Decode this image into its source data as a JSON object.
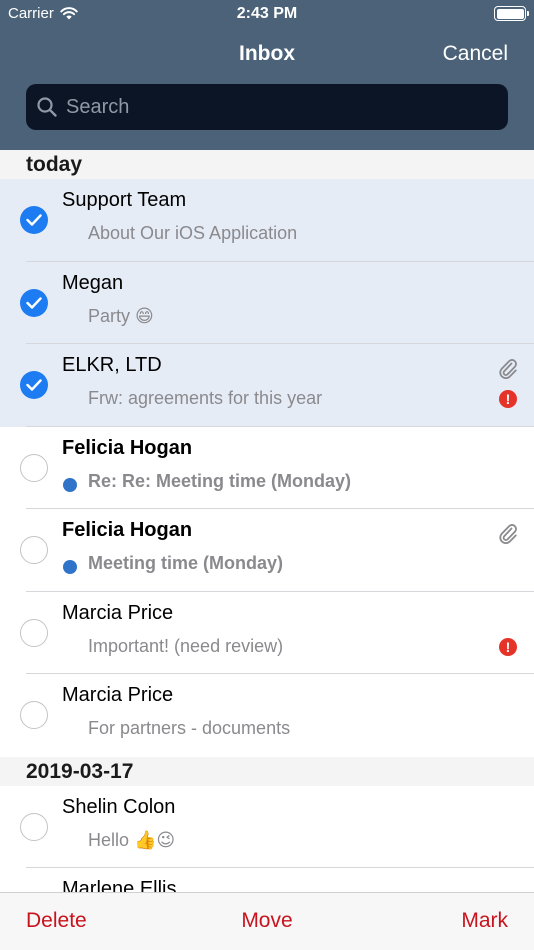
{
  "status_bar": {
    "carrier": "Carrier",
    "time": "2:43 PM"
  },
  "nav": {
    "title": "Inbox",
    "cancel": "Cancel"
  },
  "search": {
    "placeholder": "Search"
  },
  "sections": [
    {
      "title": "today",
      "rows": [
        {
          "sender": "Support Team",
          "subject": "About Our iOS Application",
          "selected": true,
          "unread": false,
          "attachment": false,
          "important": false
        },
        {
          "sender": "Megan",
          "subject": "Party 😄",
          "selected": true,
          "unread": false,
          "attachment": false,
          "important": false
        },
        {
          "sender": "ELKR, LTD",
          "subject": "Frw: agreements for this year",
          "selected": true,
          "unread": false,
          "attachment": true,
          "important": true
        },
        {
          "sender": "Felicia Hogan",
          "subject": "Re: Re: Meeting time (Monday)",
          "selected": false,
          "unread": true,
          "attachment": false,
          "important": false
        },
        {
          "sender": "Felicia Hogan",
          "subject": "Meeting time (Monday)",
          "selected": false,
          "unread": true,
          "attachment": true,
          "important": false
        },
        {
          "sender": "Marcia Price",
          "subject": "Important! (need review)",
          "selected": false,
          "unread": false,
          "attachment": false,
          "important": true
        },
        {
          "sender": "Marcia Price",
          "subject": "For partners - documents",
          "selected": false,
          "unread": false,
          "attachment": false,
          "important": false
        }
      ]
    },
    {
      "title": "2019-03-17",
      "rows": [
        {
          "sender": "Shelin Colon",
          "subject": "Hello 👍😉",
          "selected": false,
          "unread": false,
          "attachment": false,
          "important": false
        },
        {
          "sender": "Marlene     Ellis",
          "subject": "",
          "selected": false,
          "unread": false,
          "attachment": false,
          "important": false
        }
      ]
    }
  ],
  "toolbar": {
    "delete": "Delete",
    "move": "Move",
    "mark": "Mark"
  },
  "colors": {
    "header": "#4b6279",
    "accent": "#1e7cf2",
    "destructive": "#c8141e",
    "unread_dot": "#2f74c9",
    "alert": "#e5332a"
  },
  "icons": {
    "search": "search-icon",
    "wifi": "wifi-icon",
    "battery": "battery-icon",
    "attachment": "paperclip-icon",
    "important": "exclamation-icon",
    "checkmark": "checkmark-icon"
  }
}
